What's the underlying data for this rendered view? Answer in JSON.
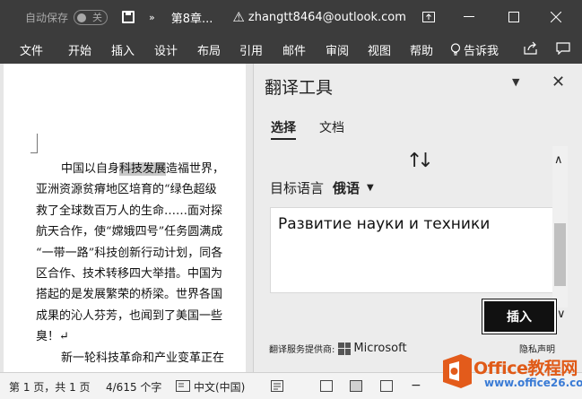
{
  "titlebar": {
    "autosave_label": "自动保存",
    "autosave_state": "关",
    "doc_title": "第8章...",
    "account": "zhangtt8464@outlook.com"
  },
  "ribbon": {
    "tabs": [
      "文件",
      "开始",
      "插入",
      "设计",
      "布局",
      "引用",
      "邮件",
      "审阅",
      "视图",
      "帮助"
    ],
    "tell_me": "告诉我"
  },
  "document": {
    "lines": [
      {
        "pre": "中国以自身",
        "hl": "科技发展",
        "post": "造福世界，"
      },
      {
        "pre": "亚洲资源贫瘠地区培育的“绿色超级"
      },
      {
        "pre": "救了全球数百万人的生命……面对探"
      },
      {
        "pre": "航天合作，使“嫦娥四号”任务圆满成"
      },
      {
        "pre": "“一带一路”科技创新行动计划，同各"
      },
      {
        "pre": "区合作、技术转移四大举措。中国为"
      },
      {
        "pre": "搭起的是发展繁荣的桥梁。世界各国"
      },
      {
        "pre": "成果的沁人芬芳，也闻到了美国一些"
      },
      {
        "pre": "臭！↵"
      },
      {
        "pre": "新一轮科技革命和产业变革正在"
      }
    ]
  },
  "translator": {
    "title": "翻译工具",
    "tabs": [
      "选择",
      "文档"
    ],
    "target_label": "目标语言",
    "target_lang": "俄语",
    "output_text": "Развитие науки и техники",
    "insert_label": "插入",
    "provider_label": "翻译服务提供商:",
    "provider_name": "Microsoft",
    "privacy_label": "隐私声明"
  },
  "statusbar": {
    "page": "第 1 页，共 1 页",
    "words": "4/615 个字",
    "language": "中文(中国)"
  },
  "watermark": {
    "brand": "Office教程网",
    "url": "www.office26.com"
  }
}
